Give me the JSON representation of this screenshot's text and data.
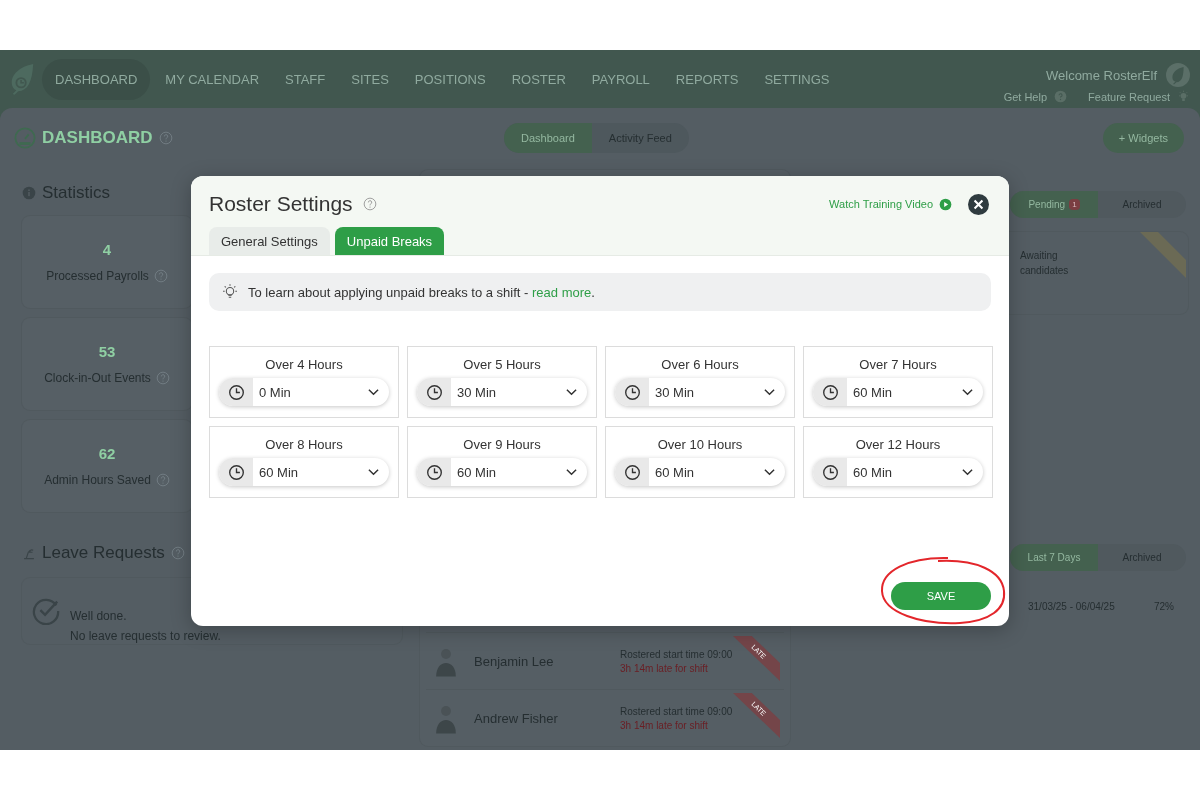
{
  "nav": {
    "items": [
      {
        "label": "DASHBOARD",
        "selected": true
      },
      {
        "label": "MY CALENDAR",
        "selected": false
      },
      {
        "label": "STAFF",
        "selected": false
      },
      {
        "label": "SITES",
        "selected": false
      },
      {
        "label": "POSITIONS",
        "selected": false
      },
      {
        "label": "ROSTER",
        "selected": false
      },
      {
        "label": "PAYROLL",
        "selected": false
      },
      {
        "label": "REPORTS",
        "selected": false
      },
      {
        "label": "SETTINGS",
        "selected": false
      }
    ],
    "welcome": "Welcome RosterElf",
    "help": "Get Help",
    "feature": "Feature Request"
  },
  "page": {
    "title": "DASHBOARD",
    "view_tabs": [
      {
        "label": "Dashboard",
        "selected": true
      },
      {
        "label": "Activity Feed",
        "selected": false
      }
    ],
    "widgets_button": "+ Widgets"
  },
  "statistics": {
    "title": "Statistics",
    "items": [
      {
        "value": "4",
        "label": "Processed Payrolls"
      },
      {
        "value": "53",
        "label": "Clock-in-Out Events"
      },
      {
        "value": "62",
        "label": "Admin Hours Saved"
      }
    ]
  },
  "leave_requests": {
    "title": "Leave Requests",
    "message": "Well done.",
    "detail": "No leave requests to review."
  },
  "late_staff": [
    {
      "name": "Benjamin Lee",
      "rostered": "Rostered start time 09:00",
      "late": "3h 14m late for shift",
      "ribbon": "LATE"
    },
    {
      "name": "Andrew Fisher",
      "rostered": "Rostered start time 09:00",
      "late": "3h 14m late for shift",
      "ribbon": "LATE"
    }
  ],
  "shift_offers": {
    "tabs": [
      {
        "label": "Pending",
        "badge": "1",
        "selected": true
      },
      {
        "label": "Archived",
        "selected": false
      }
    ],
    "status": "Awaiting candidates"
  },
  "timesheets": {
    "tabs": [
      {
        "label": "Last 7 Days",
        "selected": true
      },
      {
        "label": "Archived",
        "selected": false
      }
    ],
    "rows": [
      {
        "period": "31/03/25 - 06/04/25",
        "percent": "72%"
      }
    ]
  },
  "dialog": {
    "title": "Roster Settings",
    "video_link": "Watch Training Video",
    "tabs": [
      {
        "label": "General Settings",
        "selected": false
      },
      {
        "label": "Unpaid Breaks",
        "selected": true
      }
    ],
    "info": "To learn about applying unpaid breaks to a shift - ",
    "info_link": "read more",
    "info_end": ".",
    "breaks": [
      {
        "label": "Over 4 Hours",
        "value": "0 Min"
      },
      {
        "label": "Over 5 Hours",
        "value": "30 Min"
      },
      {
        "label": "Over 6 Hours",
        "value": "30 Min"
      },
      {
        "label": "Over 7 Hours",
        "value": "60 Min"
      },
      {
        "label": "Over 8 Hours",
        "value": "60 Min"
      },
      {
        "label": "Over 9 Hours",
        "value": "60 Min"
      },
      {
        "label": "Over 10 Hours",
        "value": "60 Min"
      },
      {
        "label": "Over 12 Hours",
        "value": "60 Min"
      }
    ],
    "save_button": "SAVE",
    "save_highlighted": true
  }
}
